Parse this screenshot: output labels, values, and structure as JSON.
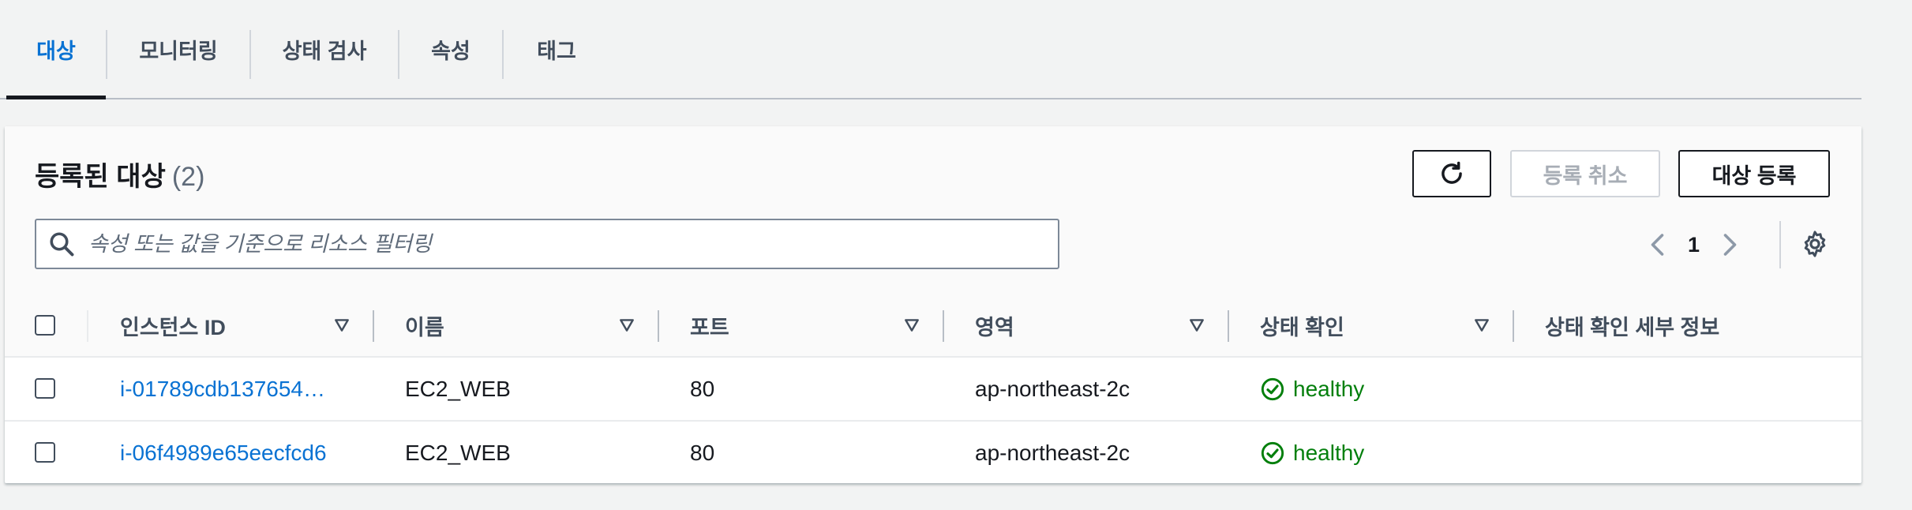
{
  "tabs": [
    {
      "label": "대상",
      "active": true
    },
    {
      "label": "모니터링",
      "active": false
    },
    {
      "label": "상태 검사",
      "active": false
    },
    {
      "label": "속성",
      "active": false
    },
    {
      "label": "태그",
      "active": false
    }
  ],
  "panel": {
    "title": "등록된 대상",
    "count": "(2)",
    "deregister_label": "등록 취소",
    "register_label": "대상 등록",
    "search_placeholder": "속성 또는 값을 기준으로 리소스 필터링",
    "page": "1"
  },
  "table": {
    "columns": [
      "인스턴스 ID",
      "이름",
      "포트",
      "영역",
      "상태 확인",
      "상태 확인 세부 정보"
    ],
    "rows": [
      {
        "instance_id": "i-01789cdb137654…",
        "name": "EC2_WEB",
        "port": "80",
        "zone": "ap-northeast-2c",
        "health": "healthy",
        "details": ""
      },
      {
        "instance_id": "i-06f4989e65eecfcd6",
        "name": "EC2_WEB",
        "port": "80",
        "zone": "ap-northeast-2c",
        "health": "healthy",
        "details": ""
      }
    ]
  },
  "colors": {
    "accent": "#0972d3",
    "healthy": "#037f0c",
    "text": "#16191f"
  },
  "icons": [
    "refresh-icon",
    "search-icon",
    "chevron-left-icon",
    "chevron-right-icon",
    "settings-icon",
    "sort-icon",
    "check-circle-icon"
  ]
}
